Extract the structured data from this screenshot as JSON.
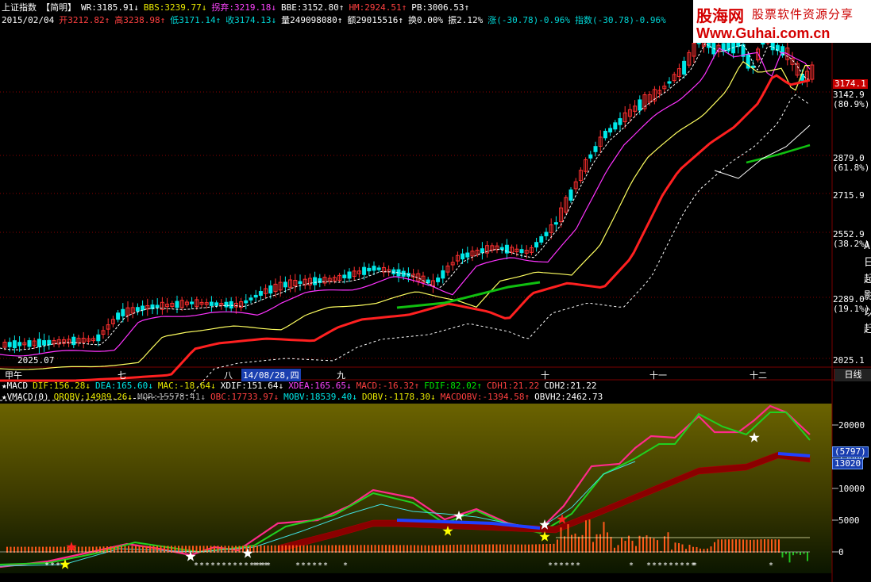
{
  "watermark": {
    "brand": "股海网",
    "slogan": "股票软件资源分享",
    "url": "Www.Guhai.com.cn"
  },
  "header": {
    "line1": [
      {
        "text": "上证指数",
        "color": "#ffffff"
      },
      {
        "text": "【简明】",
        "color": "#ffffff"
      },
      {
        "text": "WR:3185.91↓",
        "color": "#ffffff"
      },
      {
        "text": "BBS:3239.77↓",
        "color": "#e8e800"
      },
      {
        "text": "拐弃:3219.18↓",
        "color": "#ff44ff"
      },
      {
        "text": "BBE:3152.80↑",
        "color": "#ffffff"
      },
      {
        "text": "HM:2924.51↑",
        "color": "#ff4040"
      },
      {
        "text": "PB:3006.53↑",
        "color": "#ffffff"
      }
    ],
    "line2": [
      {
        "text": "2015/02/04",
        "color": "#ffffff"
      },
      {
        "text": "开3212.82↑",
        "color": "#ff4040"
      },
      {
        "text": "高3238.98↑",
        "color": "#ff4040"
      },
      {
        "text": "低3171.14↑",
        "color": "#00d8d8"
      },
      {
        "text": "收3174.13↓",
        "color": "#00d8d8"
      },
      {
        "text": "量249098080↑",
        "color": "#ffffff"
      },
      {
        "text": "额29015516↑",
        "color": "#ffffff"
      },
      {
        "text": "换0.00%",
        "color": "#ffffff"
      },
      {
        "text": "振2.12%",
        "color": "#ffffff"
      },
      {
        "text": "涨(-30.78)-0.96%",
        "color": "#00d8d8"
      },
      {
        "text": "指数(-30.78)-0.96%",
        "color": "#00d8d8"
      }
    ]
  },
  "price_axis": {
    "levels": [
      {
        "value": "3174.1",
        "pct": "",
        "kind": "current"
      },
      {
        "value": "3142.9",
        "pct": "(80.9%)",
        "kind": "level"
      },
      {
        "value": "2879.0",
        "pct": "(61.8%)",
        "kind": "level"
      },
      {
        "value": "2715.9",
        "pct": "",
        "kind": "level"
      },
      {
        "value": "2552.9",
        "pct": "(38.2%)",
        "kind": "level"
      },
      {
        "value": "2289.0",
        "pct": "(19.1%)",
        "kind": "level"
      },
      {
        "value": "2025.1",
        "pct": "",
        "kind": "level"
      }
    ],
    "side_glyphs": "A日起影以赶"
  },
  "date_axis": {
    "labels": [
      "甲午",
      "七",
      "八",
      "14/08/28,四",
      "九",
      "十",
      "十一",
      "十二"
    ],
    "period_button": "日线",
    "year_marker": "2025.07"
  },
  "indicators": {
    "macd_line": [
      {
        "text": "★MACD",
        "color": "#ffffff"
      },
      {
        "text": "DIF:156.28↓",
        "color": "#e8e800"
      },
      {
        "text": "DEA:165.60↓",
        "color": "#00e8e8"
      },
      {
        "text": "MAC:-18.64↓",
        "color": "#e8e800"
      },
      {
        "text": "XDIF:151.64↓",
        "color": "#ffffff"
      },
      {
        "text": "XDEA:165.65↓",
        "color": "#ff44ff"
      },
      {
        "text": "MACD:-16.32↑",
        "color": "#ff4040"
      },
      {
        "text": "FDIF:82.02↑",
        "color": "#00e800"
      },
      {
        "text": "CDH1:21.22",
        "color": "#ff4040"
      },
      {
        "text": "CDH2:21.22",
        "color": "#ffffff"
      }
    ],
    "vmacd_line": [
      {
        "text": "★VMACD(0)",
        "color": "#ffffff"
      },
      {
        "text": "QROBV:14989.26↓",
        "color": "#e8e800"
      },
      {
        "text": "MQR:15578.41↓",
        "color": "#aaaaaa"
      },
      {
        "text": "OBC:17733.97↓",
        "color": "#ff4040"
      },
      {
        "text": "MOBV:18539.40↓",
        "color": "#00e8e8"
      },
      {
        "text": "DOBV:-1178.30↓",
        "color": "#e8e800"
      },
      {
        "text": "MACDOBV:-1394.58↑",
        "color": "#ff4040"
      },
      {
        "text": "OBVH2:2462.73",
        "color": "#ffffff"
      }
    ]
  },
  "sub_axis": {
    "labels": [
      "20000",
      "15000",
      "10000",
      "5000",
      "0"
    ],
    "tag_top": "(5797)",
    "tag_bottom": "13020"
  },
  "colors": {
    "up": "#ff3030",
    "down": "#00e8e8",
    "ma_pink": "#ff33ff",
    "ma_yellow": "#ffff60",
    "ma_red": "#ff2020",
    "ma_green": "#10c010",
    "grid": "#7a0000"
  }
}
